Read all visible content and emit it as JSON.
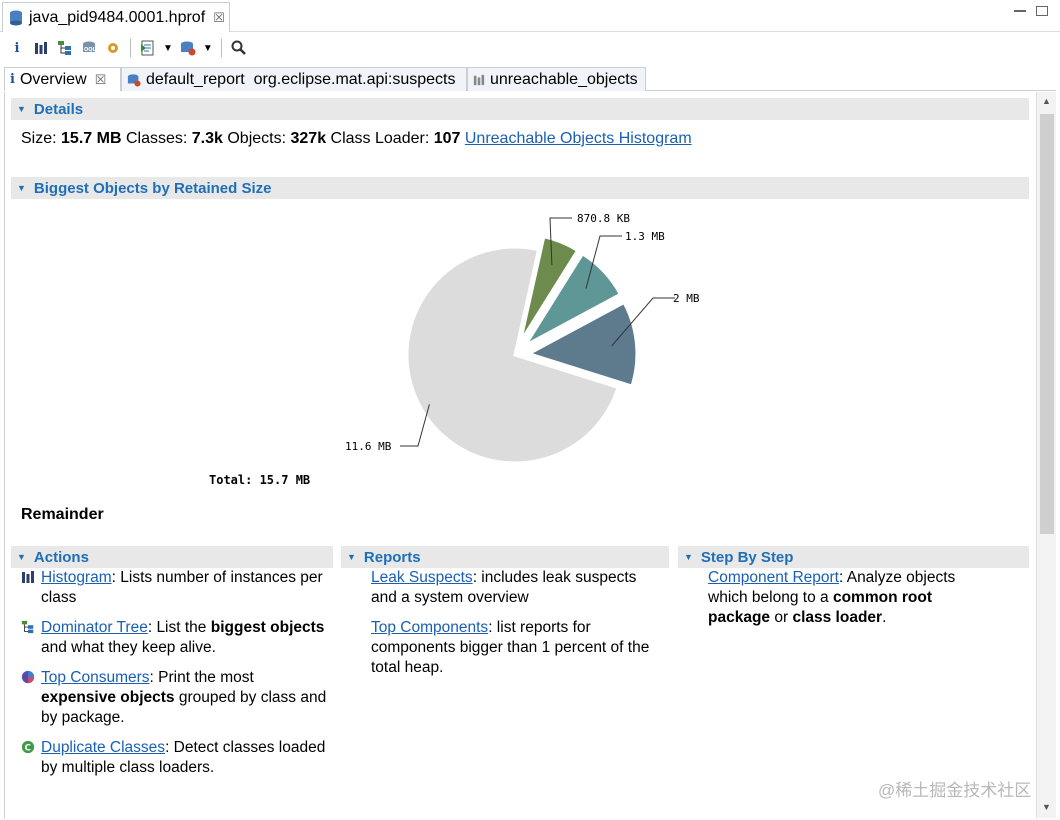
{
  "editor_tab": {
    "title": "java_pid9484.0001.hprof",
    "close": "☒"
  },
  "toolbar": {
    "buttons": [
      "info-icon",
      "histogram-icon",
      "dominator-tree-icon",
      "oql-icon",
      "heap-dump-icon",
      "run-report-icon",
      "query-browser-icon",
      "search-icon"
    ]
  },
  "pane_tabs": [
    {
      "label": "Overview",
      "close": "☒"
    },
    {
      "label": "default_report  org.eclipse.mat.api:suspects"
    },
    {
      "label": "unreachable_objects"
    }
  ],
  "details": {
    "header": "Details",
    "size_label": "Size:",
    "size_value": "15.7 MB",
    "classes_label": "Classes:",
    "classes_value": "7.3k",
    "objects_label": "Objects:",
    "objects_value": "327k",
    "loader_label": "Class Loader:",
    "loader_value": "107",
    "histogram_link": "Unreachable Objects Histogram"
  },
  "biggest": {
    "header": "Biggest Objects by Retained Size",
    "total_label": "Total: 15.7 MB",
    "remainder": "Remainder"
  },
  "chart_data": {
    "type": "pie",
    "unit": "MB",
    "slices": [
      {
        "label": "870.8 KB",
        "value": 0.85,
        "color": "#6e8b4e"
      },
      {
        "label": "1.3 MB",
        "value": 1.3,
        "color": "#5f9796"
      },
      {
        "label": "2 MB",
        "value": 2.0,
        "color": "#5e7a8d"
      },
      {
        "label": "11.6 MB",
        "value": 11.6,
        "color": "#dcdcdc"
      }
    ],
    "total": "15.7 MB"
  },
  "actions": {
    "header": "Actions",
    "histogram_link": "Histogram",
    "histogram_text": ": Lists number of instances per class",
    "dominator_link": "Dominator Tree",
    "dominator_text1": ": List the ",
    "dominator_bold": "biggest objects",
    "dominator_text2": " and what they keep alive.",
    "consumers_link": "Top Consumers",
    "consumers_text1": ": Print the most ",
    "consumers_bold": "expensive objects",
    "consumers_text2": " grouped by class and by package.",
    "duplicate_link": "Duplicate Classes",
    "duplicate_text": ": Detect classes loaded by multiple class loaders."
  },
  "reports": {
    "header": "Reports",
    "leak_link": "Leak Suspects",
    "leak_text": ": includes leak suspects and a system overview",
    "top_link": "Top Components",
    "top_text": ": list reports for components bigger than 1 percent of the total heap."
  },
  "step": {
    "header": "Step By Step",
    "component_link": "Component Report",
    "component_text1": ": Analyze objects which belong to a ",
    "component_bold": "common root package",
    "component_text2": " or ",
    "component_bold2": "class loader",
    "component_text3": "."
  },
  "watermark": "@稀土掘金技术社区",
  "colors": {
    "accent": "#1f6fb7",
    "link": "#1a5fb4",
    "section_bg": "#e8e8e8"
  }
}
